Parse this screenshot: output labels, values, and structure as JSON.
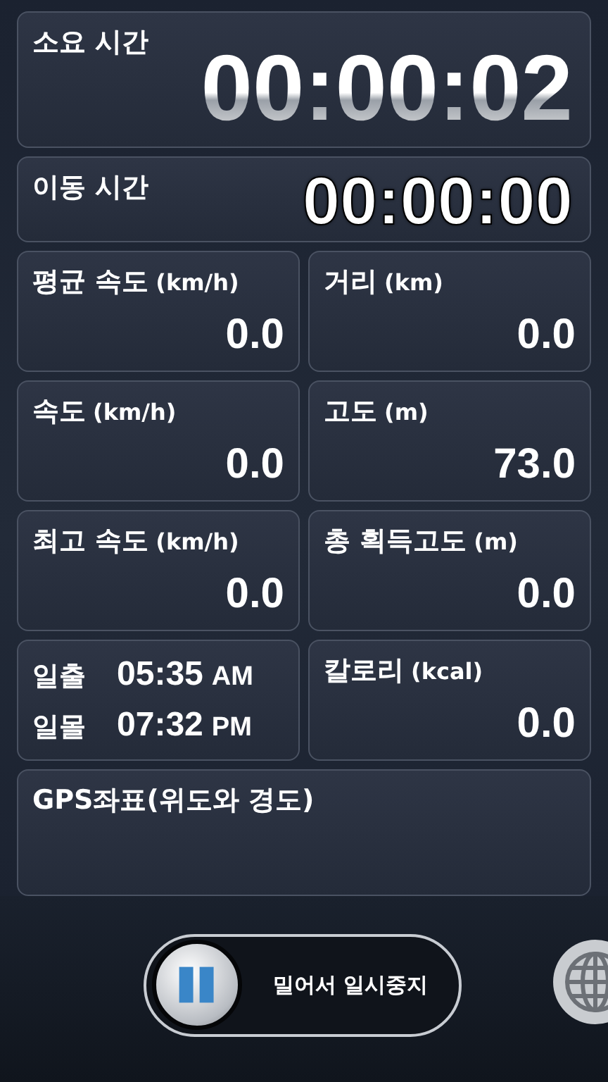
{
  "elapsed": {
    "label": "소요 시간",
    "value": "00:00:02"
  },
  "moving": {
    "label": "이동 시간",
    "value": "00:00:00"
  },
  "cells": [
    {
      "kind": "metric",
      "label": "평균 속도",
      "unit": "(km/h)",
      "value": "0.0"
    },
    {
      "kind": "metric",
      "label": "거리",
      "unit": "(km)",
      "value": "0.0"
    },
    {
      "kind": "metric",
      "label": "속도",
      "unit": "(km/h)",
      "value": "0.0"
    },
    {
      "kind": "metric",
      "label": "고도",
      "unit": "(m)",
      "value": "73.0"
    },
    {
      "kind": "metric",
      "label": "최고 속도",
      "unit": "(km/h)",
      "value": "0.0"
    },
    {
      "kind": "metric",
      "label": "총 획득고도",
      "unit": "(m)",
      "value": "0.0"
    },
    {
      "kind": "sun",
      "rows": [
        {
          "label": "일출",
          "time": "05:35",
          "period": "AM"
        },
        {
          "label": "일몰",
          "time": "07:32",
          "period": "PM"
        }
      ]
    },
    {
      "kind": "metric",
      "label": "칼로리",
      "unit": "(kcal)",
      "value": "0.0"
    }
  ],
  "gps": {
    "title": "GPS좌표(위도와 경도)"
  },
  "pause": {
    "label": "밀어서 일시중지"
  }
}
